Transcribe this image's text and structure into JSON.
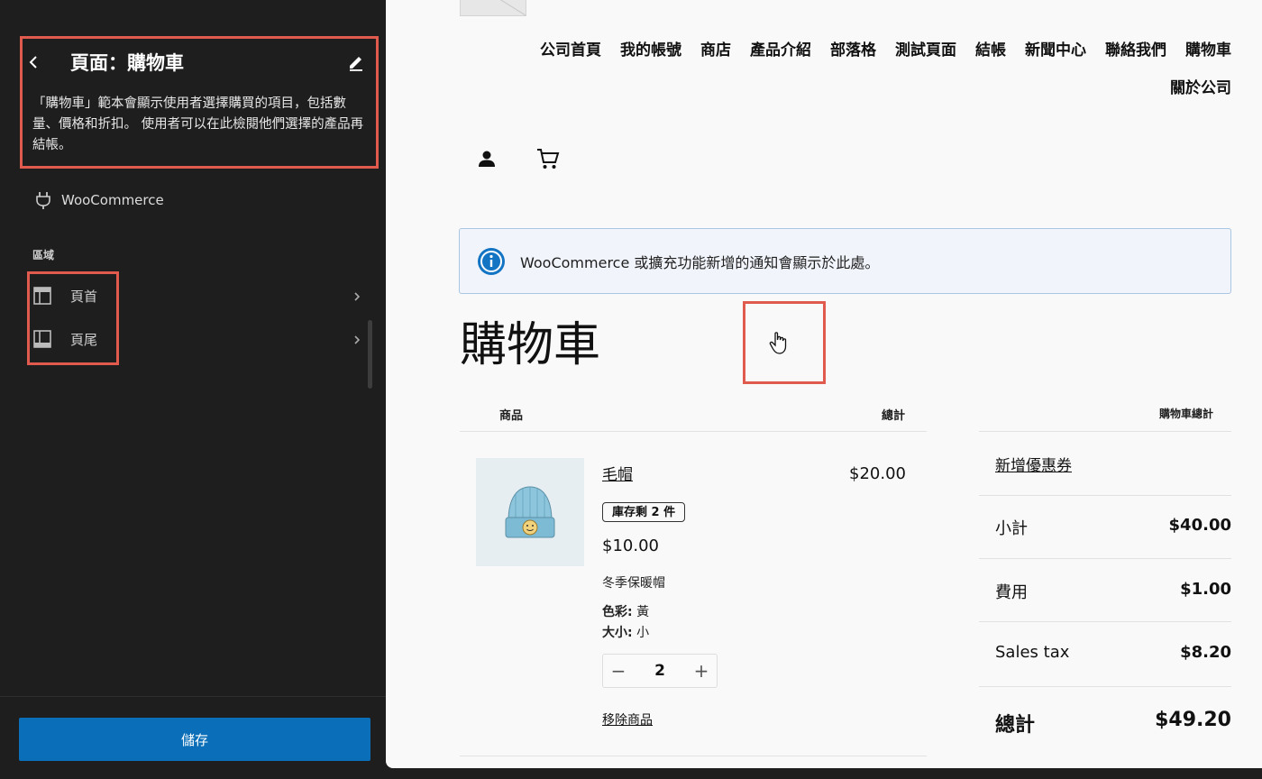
{
  "sidebar": {
    "title": "頁面：購物車",
    "description": "「購物車」範本會顯示使用者選擇購買的項目，包括數量、價格和折扣。 使用者可以在此檢閱他們選擇的產品再結帳。",
    "plugin_label": "WooCommerce",
    "areas_heading": "區域",
    "areas": [
      {
        "label": "頁首",
        "icon": "header-layout-icon"
      },
      {
        "label": "頁尾",
        "icon": "footer-layout-icon"
      }
    ],
    "save_label": "儲存"
  },
  "site": {
    "nav": [
      {
        "label": "公司首頁"
      },
      {
        "label": "我的帳號"
      },
      {
        "label": "商店"
      },
      {
        "label": "產品介紹"
      },
      {
        "label": "部落格"
      },
      {
        "label": "測試頁面"
      },
      {
        "label": "結帳"
      },
      {
        "label": "新聞中心"
      },
      {
        "label": "聯絡我們"
      },
      {
        "label": "購物車"
      },
      {
        "label": "關於公司"
      }
    ],
    "notice_text": "WooCommerce 或擴充功能新增的通知會顯示於此處。",
    "page_heading": "購物車",
    "table": {
      "col_product": "商品",
      "col_total": "總計"
    },
    "item": {
      "name": "毛帽",
      "stock_badge": "庫存剩 2 件",
      "unit_price": "$10.00",
      "description": "冬季保暖帽",
      "color_label": "色彩:",
      "color_value": "黃",
      "size_label": "大小:",
      "size_value": "小",
      "quantity": "2",
      "decrement_label": "−",
      "increment_label": "+",
      "remove_label": "移除商品",
      "line_total": "$20.00"
    },
    "summary": {
      "heading": "購物車總計",
      "coupon_label": "新增優惠券",
      "rows": [
        {
          "label": "小計",
          "value": "$40.00"
        },
        {
          "label": "費用",
          "value": "$1.00"
        },
        {
          "label": "Sales tax",
          "value": "$8.20"
        }
      ],
      "total_label": "總計",
      "total_value": "$49.20"
    }
  },
  "colors": {
    "sidebar_bg": "#1e1e1e",
    "accent": "#0a6fb8",
    "highlight": "#e05a4e",
    "notice_border": "#a9c6e2",
    "info_icon": "#1474c4"
  }
}
